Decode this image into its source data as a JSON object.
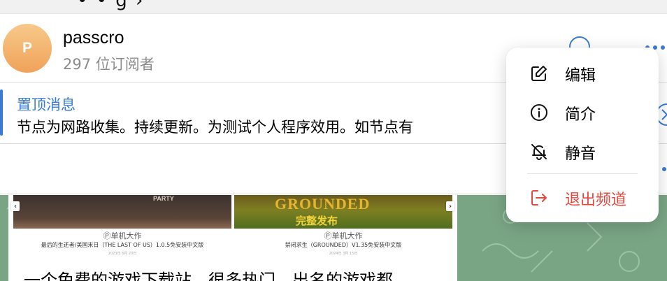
{
  "channel": {
    "name": "passcro",
    "avatar_letter": "P",
    "subscribers": "297 位订阅者"
  },
  "pinned": {
    "title": "置顶消息",
    "text": "节点为网路收集。持续更新。为测试个人程序效用。如节点有"
  },
  "menu": {
    "items": [
      {
        "label": "编辑",
        "icon": "edit-icon"
      },
      {
        "label": "简介",
        "icon": "info-icon"
      },
      {
        "label": "静音",
        "icon": "bell-off-icon"
      },
      {
        "label": "退出频道",
        "icon": "leave-icon"
      }
    ]
  },
  "message": {
    "cards": [
      {
        "img_label": "PARTY",
        "brand": "Ⓟ单机大作",
        "game": "最后的生还者/美国末日（THE LAST OF US）1.0.5免安装中文版",
        "date": "2023年 6月 20日"
      },
      {
        "img_title": "GROUNDED",
        "img_sub": "完整发布",
        "brand": "Ⓟ单机大作",
        "game": "禁闭求生（GROUNDED）V1.35免安装中文版",
        "date": "2024年 3月 15日"
      }
    ],
    "text": "一个免费的游戏下载站，很多热门、出名的游戏都"
  },
  "colors": {
    "accent": "#3a7bd5",
    "danger": "#e5483f",
    "chat_background": "#7aa585"
  }
}
